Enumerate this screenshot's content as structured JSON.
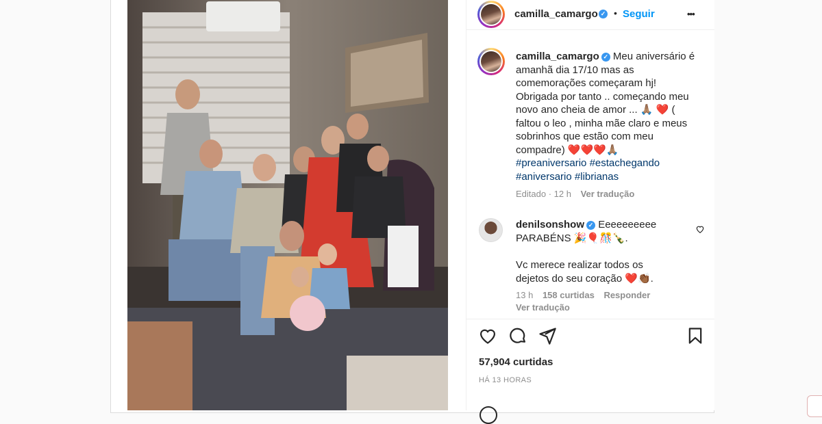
{
  "post": {
    "author": {
      "username": "camilla_camargo",
      "follow_label": "Seguir",
      "more_label": "•••"
    },
    "caption": {
      "username": "camilla_camargo",
      "text": "Meu aniversário é amanhã dia 17/10 mas as comemorações começaram hj! Obrigada por tanto .. começando meu novo ano cheia de amor ... 🙏🏽 ❤️ ( faltou o leo , minha mãe claro e meus sobrinhos que estão com meu compadre) ❤️❤️❤️🙏🏽",
      "hashtags": [
        "#preaniversario",
        "#estachegando",
        "#aniversario",
        "#librianas"
      ],
      "edited_label": "Editado · 12 h",
      "translate_label": "Ver tradução"
    },
    "comment": {
      "username": "denilsonshow",
      "text_line1": "Eeeeeeeeee PARABÉNS 🎉🎈🎊🍾.",
      "text_line2": "Vc merece realizar todos os dejetos do seu coração ❤️👏🏾.",
      "time": "13 h",
      "likes": "158 curtidas",
      "reply_label": "Responder",
      "translate_label": "Ver tradução"
    },
    "likes_label": "57,904 curtidas",
    "time_label": "HÁ 13 HORAS"
  },
  "icons": [
    "heart-icon",
    "comment-icon",
    "share-icon",
    "bookmark-icon",
    "verified-badge-icon",
    "more-icon"
  ],
  "colors": {
    "link_blue": "#0095f6",
    "hashtag_blue": "#00376b",
    "verified": "#3897f0",
    "heart_red": "#ed4956"
  }
}
